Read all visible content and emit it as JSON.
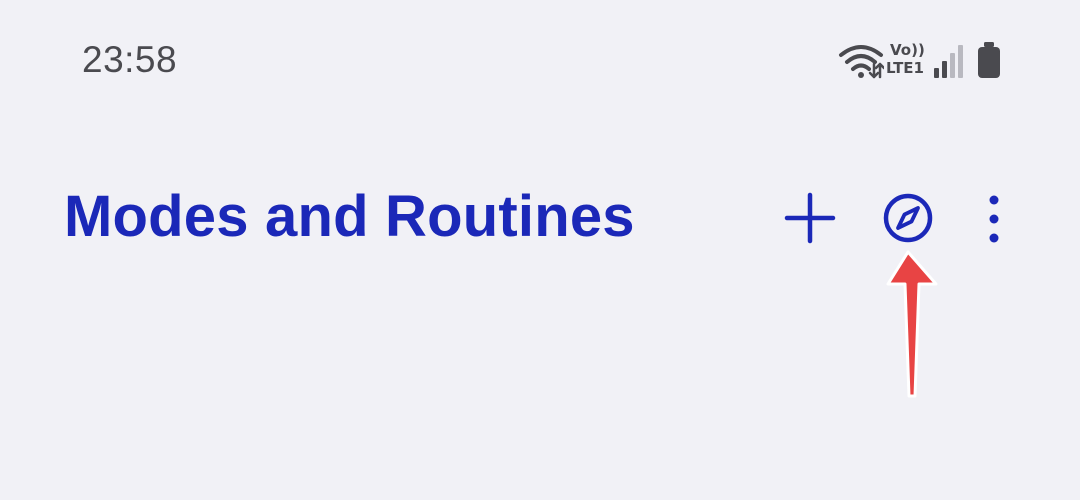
{
  "status_bar": {
    "time": "23:58",
    "network_vo": "Vo))",
    "network_lte": "LTE1",
    "icons": [
      "wifi-icon",
      "volte-lte-icon",
      "signal-icon",
      "battery-icon"
    ]
  },
  "header": {
    "title": "Modes and Routines",
    "actions": [
      {
        "name": "add-button",
        "icon": "plus-icon"
      },
      {
        "name": "discover-button",
        "icon": "compass-icon"
      },
      {
        "name": "more-options-button",
        "icon": "more-vertical-icon"
      }
    ]
  },
  "annotation": {
    "icon": "red-arrow-icon"
  },
  "colors": {
    "background": "#f1f1f6",
    "accent": "#1b28b8",
    "status_text": "#4a4a4f",
    "annotation": "#e84444"
  }
}
